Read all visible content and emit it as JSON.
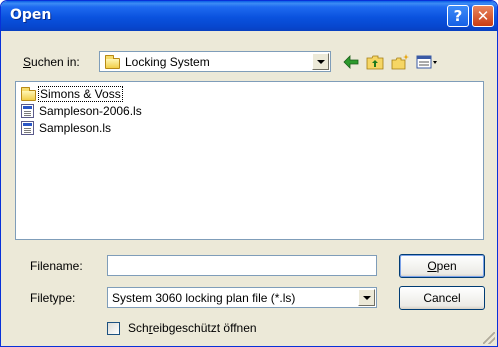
{
  "window": {
    "title": "Open",
    "help": "?",
    "close": "✕"
  },
  "lookin": {
    "label_pre": "",
    "label_u": "S",
    "label_post": "uchen in:",
    "value": "Locking System"
  },
  "toolbar": {
    "icons": [
      "back-icon",
      "up-folder-icon",
      "new-folder-icon",
      "view-menu-icon"
    ]
  },
  "files": [
    {
      "name": "Simons & Voss",
      "type": "folder"
    },
    {
      "name": "Sampleson-2006.ls",
      "type": "file"
    },
    {
      "name": "Sampleson.ls",
      "type": "file"
    }
  ],
  "filename": {
    "label": "Filename:",
    "value": ""
  },
  "filetype": {
    "label": "Filetype:",
    "value": "System 3060 locking plan file (*.ls)"
  },
  "buttons": {
    "open_u": "O",
    "open_rest": "pen",
    "cancel": "Cancel"
  },
  "readonly": {
    "pre": "Sch",
    "u": "r",
    "post": "eibgeschützt öffnen"
  }
}
